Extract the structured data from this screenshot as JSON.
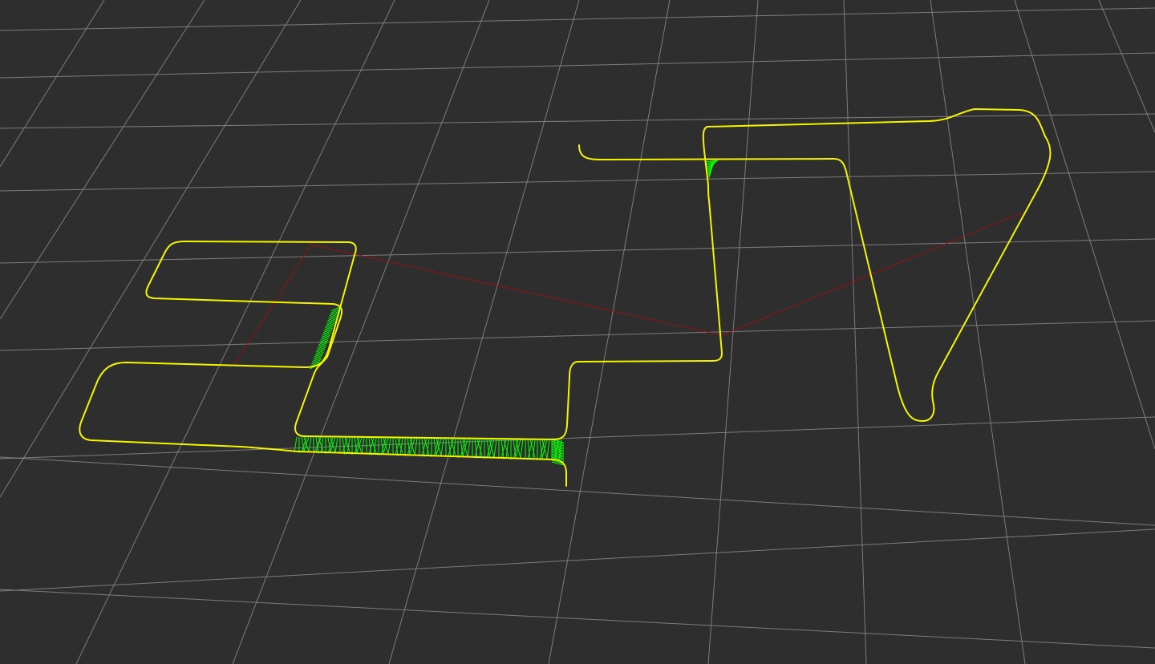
{
  "scene": {
    "colors": {
      "background": "#2e2e2e",
      "grid": "#8a8a8a",
      "trajectory": "#f5f500",
      "loop_closure": "#00ff00",
      "constraint_edge": "#a01010"
    },
    "icons": {
      "grid": "ground-grid",
      "trajectory": "pose-graph-trajectory",
      "loop_closure": "loop-closure-constraints",
      "constraint_edge": "odometry-constraint-edges"
    }
  }
}
